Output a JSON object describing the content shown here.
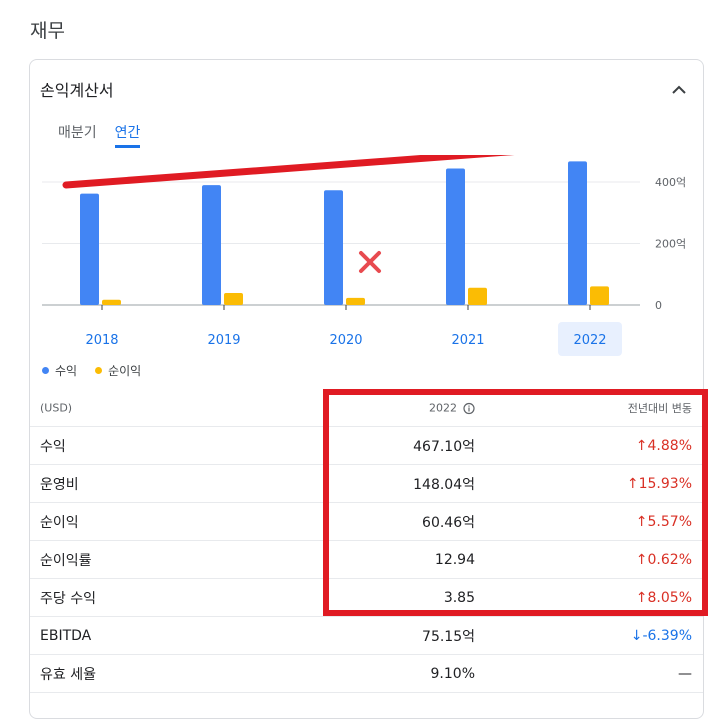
{
  "section_title": "재무",
  "card": {
    "title": "손익계산서",
    "tabs": [
      "매분기",
      "연간"
    ],
    "active_tab": "연간"
  },
  "chart_data": {
    "type": "bar",
    "categories": [
      "2018",
      "2019",
      "2020",
      "2021",
      "2022"
    ],
    "series": [
      {
        "name": "수익",
        "color": "#4285f4",
        "values": [
          362,
          390,
          373,
          444,
          467.1
        ]
      },
      {
        "name": "순이익",
        "color": "#fbbc04",
        "values": [
          17,
          39,
          23,
          56,
          60.46
        ]
      }
    ],
    "ylim": [
      0,
      480
    ],
    "y_ticks": [
      "0",
      "200억",
      "400억"
    ],
    "y_tick_values": [
      0,
      200,
      400
    ],
    "selected_category": "2022"
  },
  "table": {
    "header": {
      "label": "(USD)",
      "value": "2022",
      "change": "전년대비 변동"
    },
    "rows": [
      {
        "label": "수익",
        "value": "467.10억",
        "change": "4.88%",
        "direction": "up"
      },
      {
        "label": "운영비",
        "value": "148.04억",
        "change": "15.93%",
        "direction": "up"
      },
      {
        "label": "순이익",
        "value": "60.46억",
        "change": "5.57%",
        "direction": "up"
      },
      {
        "label": "순이익률",
        "value": "12.94",
        "change": "0.62%",
        "direction": "up"
      },
      {
        "label": "주당 수익",
        "value": "3.85",
        "change": "8.05%",
        "direction": "up"
      },
      {
        "label": "EBITDA",
        "value": "75.15억",
        "change": "-6.39%",
        "direction": "down"
      },
      {
        "label": "유효 세율",
        "value": "9.10%",
        "change": "—",
        "direction": "none"
      }
    ]
  },
  "colors": {
    "accent": "#1a73e8",
    "up": "#d93025",
    "annotation": "#e01b23"
  }
}
